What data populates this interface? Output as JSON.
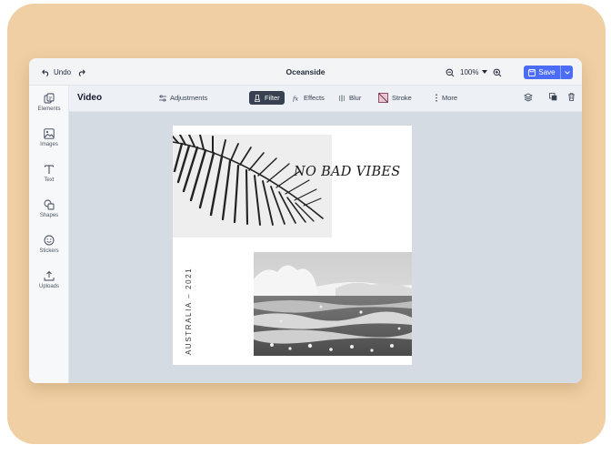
{
  "topbar": {
    "undo_label": "Undo",
    "title": "Oceanside",
    "zoom": "100%",
    "save_label": "Save"
  },
  "toolbar": {
    "section_title": "Video",
    "adjustments": "Adjustments",
    "filter": "Filter",
    "effects": "Effects",
    "blur": "Blur",
    "stroke": "Stroke",
    "more": "More"
  },
  "sidebar": {
    "items": [
      {
        "label": "Elements",
        "icon": "elements-icon"
      },
      {
        "label": "Images",
        "icon": "image-icon"
      },
      {
        "label": "Text",
        "icon": "text-icon"
      },
      {
        "label": "Shapes",
        "icon": "shapes-icon"
      },
      {
        "label": "Stickers",
        "icon": "sticker-icon"
      },
      {
        "label": "Uploads",
        "icon": "upload-icon"
      }
    ]
  },
  "design": {
    "headline": "NO BAD VIBES",
    "vertical_text": "AUSTRALIA – 2021"
  },
  "colors": {
    "accent": "#4a6cf7",
    "frame": "#efcfa3",
    "canvas": "#d5dbe3",
    "active_tool": "#374151"
  }
}
